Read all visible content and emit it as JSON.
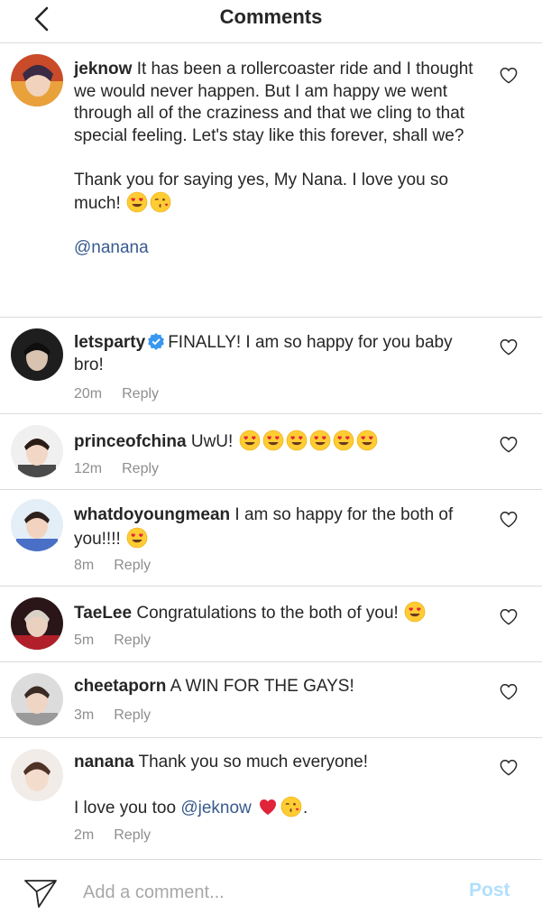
{
  "header": {
    "title": "Comments"
  },
  "comments": [
    {
      "username": "jeknow",
      "text": "It has been a rollercoaster ride and I thought we would never happen. But I am happy we went through all of the craziness and that we cling to that special feeling. Let's stay like this forever, shall we?",
      "text2": "Thank you for saying yes, My Nana. I love you so much!",
      "mention": "@nanana"
    },
    {
      "username": "letsparty",
      "verified": true,
      "text": "FINALLY! I am so happy for you baby bro!",
      "time": "20m",
      "reply": "Reply"
    },
    {
      "username": "princeofchina",
      "text": "UwU!",
      "time": "12m",
      "reply": "Reply"
    },
    {
      "username": "whatdoyoungmean",
      "text": "I am so happy for the both of you!!!!",
      "time": "8m",
      "reply": "Reply"
    },
    {
      "username": "TaeLee",
      "text": "Congratulations to the both of you!",
      "time": "5m",
      "reply": "Reply"
    },
    {
      "username": "cheetaporn",
      "text": "A WIN FOR THE GAYS!",
      "time": "3m",
      "reply": "Reply"
    },
    {
      "username": "nanana",
      "text": "Thank you so much everyone!",
      "text2": "I love you too",
      "mention": "@jeknow",
      "trail": ".",
      "time": "2m",
      "reply": "Reply"
    }
  ],
  "composer": {
    "placeholder": "Add a comment...",
    "post_label": "Post"
  },
  "colors": {
    "link": "#385a8f",
    "post_disabled": "#b2dffc",
    "meta": "#8e8e8e",
    "verified": "#3897f0"
  }
}
